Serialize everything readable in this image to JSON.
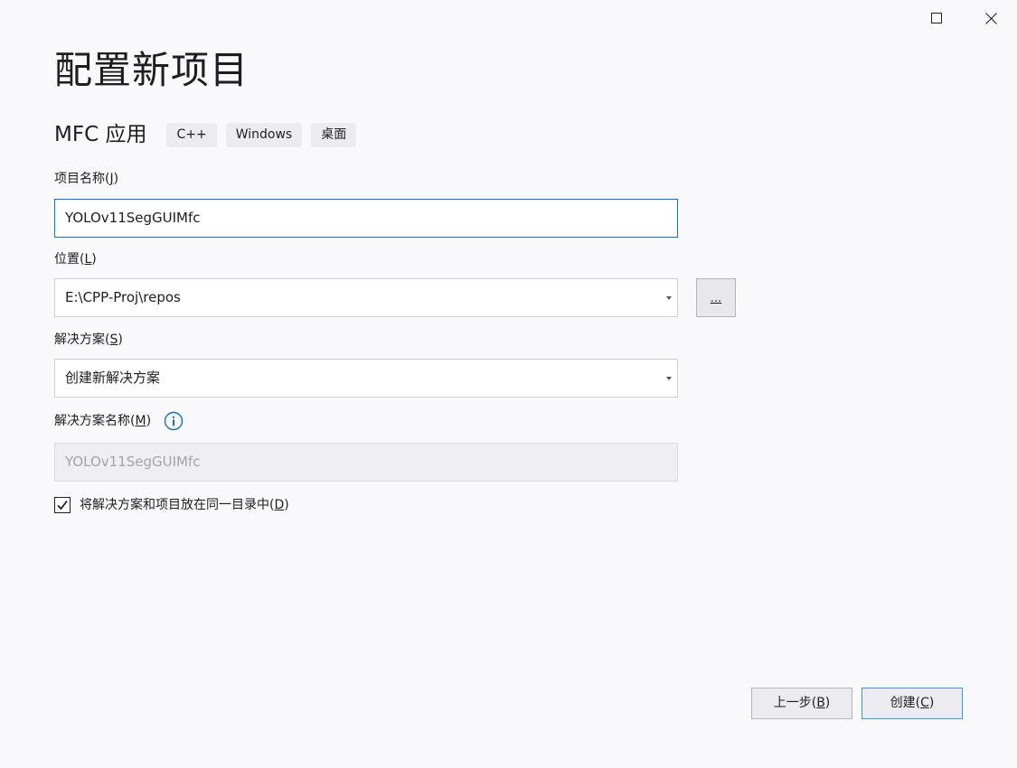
{
  "window": {
    "maximize_icon": "maximize-icon",
    "close_icon": "close-icon"
  },
  "page": {
    "title": "配置新项目"
  },
  "template": {
    "name": "MFC 应用",
    "tags": [
      "C++",
      "Windows",
      "桌面"
    ]
  },
  "project_name": {
    "label": "项目名称",
    "access_key": "J",
    "value": "YOLOv11SegGUIMfc"
  },
  "location": {
    "label": "位置",
    "access_key": "L",
    "value": "E:\\CPP-Proj\\repos",
    "browse_label": "..."
  },
  "solution": {
    "label": "解决方案",
    "access_key": "S",
    "value": "创建新解决方案"
  },
  "solution_name": {
    "label": "解决方案名称",
    "access_key": "M",
    "value": "YOLOv11SegGUIMfc",
    "info_icon": "info-icon"
  },
  "same_directory": {
    "label": "将解决方案和项目放在同一目录中",
    "access_key": "D",
    "checked": true
  },
  "buttons": {
    "back_label": "上一步",
    "back_key": "B",
    "create_label": "创建",
    "create_key": "C"
  },
  "colors": {
    "accent": "#007acc",
    "primary_border": "#3399ff",
    "background": "#f9f9fb"
  }
}
